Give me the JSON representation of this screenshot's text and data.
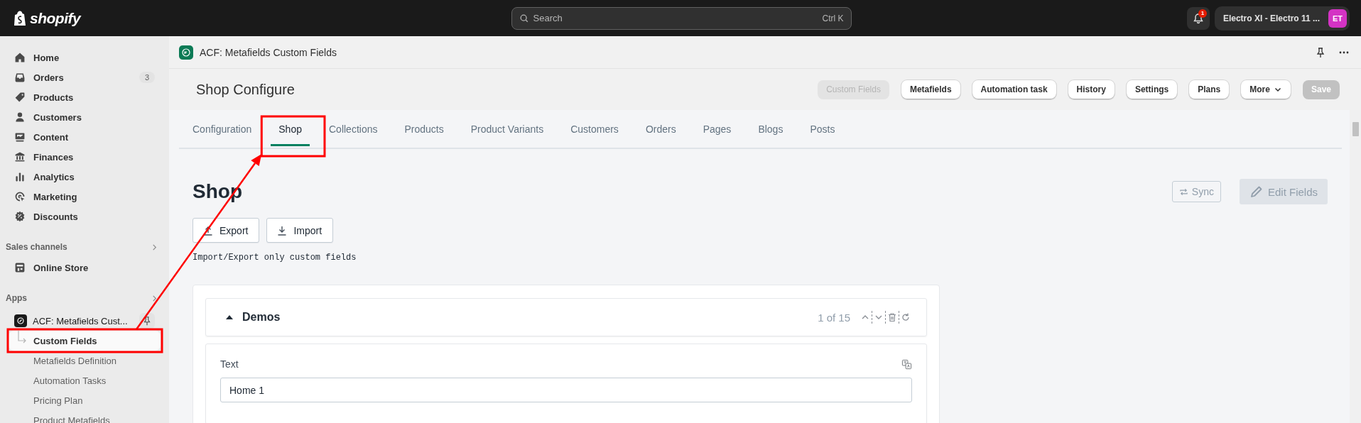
{
  "top_bar": {
    "logo": "shopify",
    "search": {
      "placeholder": "Search",
      "shortcut": "Ctrl K"
    },
    "notification_count": "1",
    "store": {
      "name": "Electro XI - Electro 11 ...",
      "initials": "ET"
    }
  },
  "sidebar": {
    "items": [
      {
        "label": "Home",
        "selected": false
      },
      {
        "label": "Orders",
        "badge": "3",
        "selected": false
      },
      {
        "label": "Products",
        "selected": false
      },
      {
        "label": "Customers",
        "selected": false
      },
      {
        "label": "Content",
        "selected": false
      },
      {
        "label": "Finances",
        "selected": false
      },
      {
        "label": "Analytics",
        "selected": false
      },
      {
        "label": "Marketing",
        "selected": false
      },
      {
        "label": "Discounts",
        "selected": false
      }
    ],
    "sections": [
      {
        "title": "Sales channels",
        "items": [
          {
            "label": "Online Store",
            "selected": false
          }
        ]
      },
      {
        "title": "Apps",
        "items": [
          {
            "label": "ACF: Metafields Cust...",
            "selected": false,
            "children": [
              {
                "label": "Custom Fields",
                "selected": true,
                "highlighted": true
              },
              {
                "label": "Metafields Definition",
                "selected": false,
                "highlighted": false
              },
              {
                "label": "Automation Tasks",
                "selected": false,
                "highlighted": false
              },
              {
                "label": "Pricing Plan",
                "selected": false,
                "highlighted": false
              },
              {
                "label": "Product Metafields",
                "selected": false,
                "highlighted": false
              }
            ]
          }
        ]
      }
    ]
  },
  "app_bar": {
    "title": "ACF: Metafields Custom Fields"
  },
  "page_header": {
    "title": "Shop Configure",
    "actions": [
      {
        "label": "Custom Fields",
        "kind": "button",
        "disabled": true
      },
      {
        "label": "Metafields",
        "kind": "button",
        "disabled": false
      },
      {
        "label": "Automation task",
        "kind": "button",
        "disabled": false
      },
      {
        "label": "History",
        "kind": "button",
        "disabled": false
      },
      {
        "label": "Settings",
        "kind": "button",
        "disabled": false
      },
      {
        "label": "Plans",
        "kind": "button",
        "disabled": false
      },
      {
        "label": "More",
        "kind": "menu",
        "disabled": false
      },
      {
        "label": "Save",
        "kind": "primary",
        "disabled": true
      }
    ]
  },
  "tabs": [
    {
      "label": "Configuration",
      "selected": false,
      "highlighted": false
    },
    {
      "label": "Shop",
      "selected": true,
      "highlighted": true
    },
    {
      "label": "Collections",
      "selected": false,
      "highlighted": false
    },
    {
      "label": "Products",
      "selected": false,
      "highlighted": false
    },
    {
      "label": "Product Variants",
      "selected": false,
      "highlighted": false
    },
    {
      "label": "Customers",
      "selected": false,
      "highlighted": false
    },
    {
      "label": "Orders",
      "selected": false,
      "highlighted": false
    },
    {
      "label": "Pages",
      "selected": false,
      "highlighted": false
    },
    {
      "label": "Blogs",
      "selected": false,
      "highlighted": false
    },
    {
      "label": "Posts",
      "selected": false,
      "highlighted": false
    }
  ],
  "section": {
    "title": "Shop",
    "actions": [
      {
        "label": "Sync",
        "kind": "sync"
      },
      {
        "label": "Edit Fields",
        "kind": "edit"
      }
    ],
    "transfer": [
      {
        "label": "Export",
        "kind": "export"
      },
      {
        "label": "Import",
        "kind": "import"
      }
    ],
    "note": "Import/Export only custom fields",
    "group": {
      "title": "Demos",
      "expanded": true,
      "position": "1 of 15",
      "fields": [
        {
          "label": "Text",
          "value": "Home 1"
        }
      ]
    }
  },
  "annotations": {
    "arrow": true
  }
}
